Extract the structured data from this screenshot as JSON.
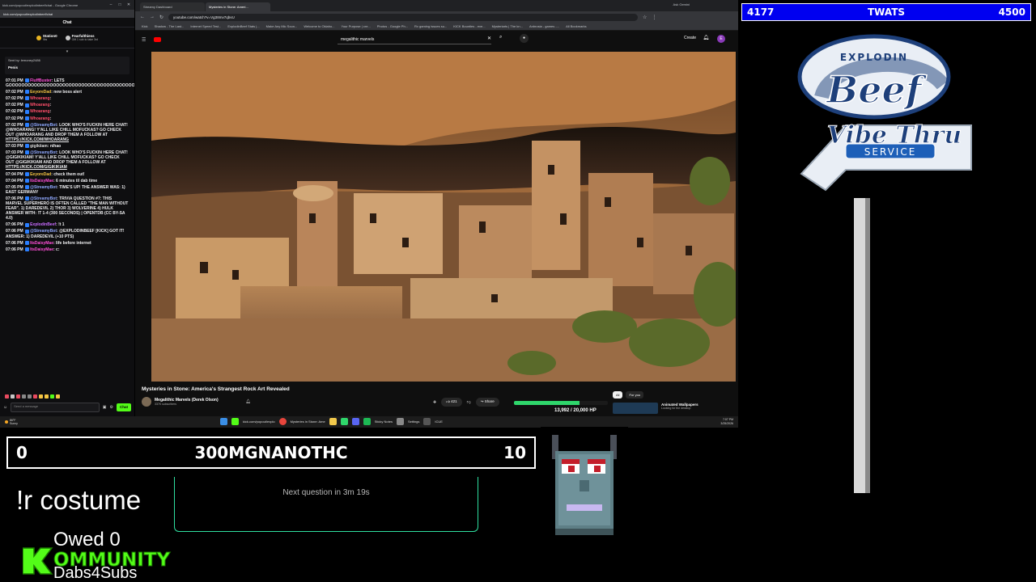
{
  "chat_window": {
    "title": "kick.com/popout/explodinbeef/chat - Google Chrome",
    "url": "kick.com/popout/explodinbeef/chat",
    "header": "Chat",
    "pinned": [
      {
        "name": "Station0",
        "sub": "!lbs"
      },
      {
        "name": "Fearfulthiess",
        "sub": "Gift 1 sub to take 3rd"
      }
    ],
    "sent_by": "Sent by: lemoney2486",
    "sent_message": "Penis",
    "messages": [
      {
        "time": "07:01 PM",
        "user": "FluffBuster",
        "user_color": "#ff4fd8",
        "text": ": LETS GOOOOOOOOOOOOOOOOOOOOOOOOOOOOOOOOOOOOOOOOOOOOOOOOOOOOOOOOOOOOOOOOOOOOOOOOOOOOOOOOOOO"
      },
      {
        "time": "07:02 PM",
        "user": "EeyoreDad",
        "user_color": "#f5c542",
        "text": ": new boss alert"
      },
      {
        "time": "07:02 PM",
        "user": "Whoarang",
        "user_color": "#ff4f6a",
        "text": ": "
      },
      {
        "time": "07:02 PM",
        "user": "Whoarang",
        "user_color": "#ff4f6a",
        "text": ": "
      },
      {
        "time": "07:02 PM",
        "user": "Whoarang",
        "user_color": "#ff4f6a",
        "text": ": "
      },
      {
        "time": "07:02 PM",
        "user": "Whoarang",
        "user_color": "#ff4f6a",
        "text": ": "
      },
      {
        "time": "07:02 PM",
        "user": "@StreamyBot",
        "user_color": "#8fa8ff",
        "text": ": LOOK WHO'S FUCKIN HERE CHAT! @WHOARANG! Y'ALL LIKE CHILL MOFUCKAS? GO CHECK OUT @WHOARANG AND DROP THEM A FOLLOW AT ",
        "link": "HTTPS://KICK.COM/WHOARANG"
      },
      {
        "time": "07:03 PM",
        "user": "gigikiiam",
        "user_color": "#dddddd",
        "text": ": nihao"
      },
      {
        "time": "07:03 PM",
        "user": "@StreamyBot",
        "user_color": "#8fa8ff",
        "text": ": LOOK WHO'S FUCKIN HERE CHAT! @GIGIKIKIAM! Y'ALL LIKE CHILL MOFUCKAS? GO CHECK OUT @GIGIKIKIAM AND DROP THEM A FOLLOW AT ",
        "link": "HTTPS://KICK.COM/GIGIKIKIAM"
      },
      {
        "time": "07:04 PM",
        "user": "EeyoreDad",
        "user_color": "#f5c542",
        "text": ": check them out!"
      },
      {
        "time": "07:04 PM",
        "user": "ItsDaisyMae",
        "user_color": "#ff4fd8",
        "text": ": 6 minutes til dab time"
      },
      {
        "time": "07:05 PM",
        "user": "@StreamyBot",
        "user_color": "#8fa8ff",
        "text": ": TIME'S UP! THE ANSWER WAS: 1) EAST GERMANY"
      },
      {
        "time": "07:06 PM",
        "user": "@StreamyBot",
        "user_color": "#8fa8ff",
        "text": ": TRIVIA QUESTION #7: THIS MARVEL SUPERHERO IS OFTEN CALLED \"THE MAN WITHOUT FEAR\". 1) DAREDEVIL 2) THOR 3) WOLVERINE 4) HULK ANSWER WITH: !T 1-4 (300 SECONDS) | OPENTDB (CC BY-SA 4.0)"
      },
      {
        "time": "07:06 PM",
        "user": "ExplodinBeef",
        "user_color": "#c86bff",
        "text": ": !t 1"
      },
      {
        "time": "07:06 PM",
        "user": "@StreamyBot",
        "user_color": "#8fa8ff",
        "text": ": @EXPLODINBEEF [KICK] GOT IT! ANSWER: 1) DAREDEVIL (+10 PTS)"
      },
      {
        "time": "07:06 PM",
        "user": "ItsDaisyMae",
        "user_color": "#ff4fd8",
        "text": ": life before internet"
      },
      {
        "time": "07:06 PM",
        "user": "ItsDaisyMae",
        "user_color": "#ff4fd8",
        "text": ": c:"
      }
    ],
    "input_placeholder": "Send a message",
    "send_label": "Chat"
  },
  "browser": {
    "tabs": [
      "Streamy Dashboard",
      "Mysteries in Stone: Ameri..."
    ],
    "ask_gemini": "Ask Gemini",
    "url": "youtube.com/watch?v=Vg38mv7qbvU",
    "bookmarks": [
      "Kick",
      "Shadow - The Last...",
      "Internet Speed Test...",
      "ExplodinBeef Stats |...",
      "Make Any Mic Soun...",
      "Welcome to Okiaho...",
      "Your Purpose | cre...",
      "Photos - Google Ph...",
      "Rv gaming issues su...",
      "KICK Bounties - eve...",
      "Mysteriarts | The kn...",
      "Anbrosia - games -...",
      "All Bookmarks"
    ],
    "search_query": "megalithic marvels",
    "create_label": "Create",
    "avatar_letter": "E"
  },
  "video": {
    "title": "Mysteries in Stone: America's Strangest Rock Art Revealed",
    "channel": "Megalithic Marvels (Derek Olson)",
    "subscribers": "337K subscribers",
    "likes": "421",
    "share": "Share",
    "goal_text": "13,992 / 20,000 HP",
    "goal_fraction": 0.6996,
    "chips": [
      "All",
      "For you"
    ],
    "rec_title": "Animated Wallpapers",
    "rec_sub": "Looking for the desktop"
  },
  "taskbar": {
    "temp": "86°F",
    "weather": "Sunny",
    "apps": [
      "kick.com/popout/explo",
      "Mysteries in Stone: Ame",
      "Sticky Notes",
      "Settings",
      "ICUE"
    ],
    "time": "7:07 PM",
    "date": "3/25/2026"
  },
  "top_scoreboard": {
    "left": "4177",
    "name": "TWATS",
    "right": "4500"
  },
  "logo": {
    "line1": "EXPLODIN",
    "line2": "Beef",
    "line3": "Vibe Thru",
    "line4": "SERVICE"
  },
  "bottom_scoreboard": {
    "left": "0",
    "name": "300MGNANOTHC",
    "right": "10"
  },
  "next_question": "Next question in 3m 19s",
  "costume_command": "!r costume",
  "owed": "Owed 0",
  "kommunity": "OMMUNITY",
  "dabs": "Dabs4Subs",
  "colors": {
    "kick_green": "#53fc18",
    "score_blue": "#0000f0",
    "timer_border": "#2fe0a0"
  }
}
